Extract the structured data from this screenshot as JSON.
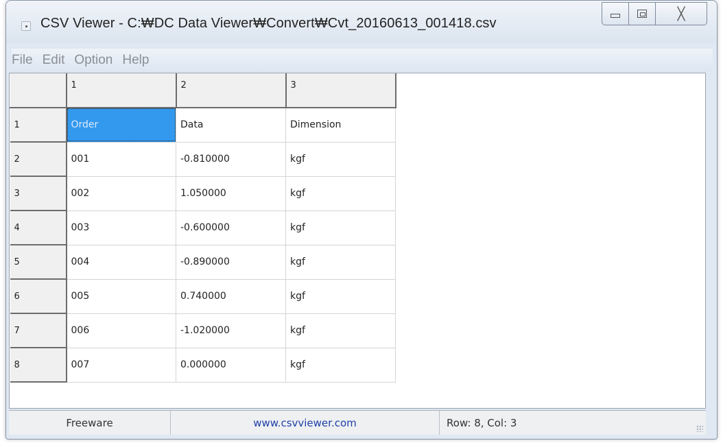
{
  "window": {
    "title": "CSV Viewer - C:₩DC Data Viewer₩Convert₩Cvt_20160613_001418.csv",
    "icon": "app-icon",
    "controls": {
      "minimize": "minimize-icon",
      "maximize": "maximize-icon",
      "close": "╳"
    }
  },
  "menu": {
    "items": [
      "File",
      "Edit",
      "Option",
      "Help"
    ]
  },
  "grid": {
    "column_headers": [
      "1",
      "2",
      "3"
    ],
    "rows": [
      {
        "num": "1",
        "cells": [
          "Order",
          "Data",
          "Dimension"
        ]
      },
      {
        "num": "2",
        "cells": [
          "001",
          "-0.810000",
          "kgf"
        ]
      },
      {
        "num": "3",
        "cells": [
          "002",
          "1.050000",
          "kgf"
        ]
      },
      {
        "num": "4",
        "cells": [
          "003",
          "-0.600000",
          "kgf"
        ]
      },
      {
        "num": "5",
        "cells": [
          "004",
          "-0.890000",
          "kgf"
        ]
      },
      {
        "num": "6",
        "cells": [
          "005",
          "0.740000",
          "kgf"
        ]
      },
      {
        "num": "7",
        "cells": [
          "006",
          "-1.020000",
          "kgf"
        ]
      },
      {
        "num": "8",
        "cells": [
          "007",
          "0.000000",
          "kgf"
        ]
      }
    ],
    "selected_cell": {
      "row": 1,
      "col": 1
    },
    "selection_color": "#3399ee"
  },
  "status": {
    "left": "Freeware",
    "center": "www.csvviewer.com",
    "right": "Row: 8, Col: 3"
  }
}
